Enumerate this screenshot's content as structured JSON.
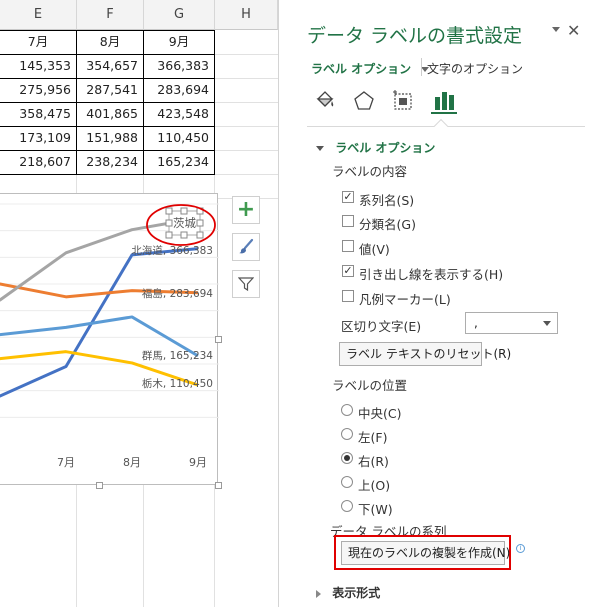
{
  "sheet": {
    "columns": [
      "E",
      "F",
      "G",
      "H"
    ],
    "months": [
      "7月",
      "8月",
      "9月"
    ],
    "rows": [
      [
        "145,353",
        "354,657",
        "366,383"
      ],
      [
        "275,956",
        "287,541",
        "283,694"
      ],
      [
        "358,475",
        "401,865",
        "423,548"
      ],
      [
        "173,109",
        "151,988",
        "110,450"
      ],
      [
        "218,607",
        "238,234",
        "165,234"
      ]
    ]
  },
  "chart_data": {
    "type": "line",
    "categories": [
      "7月",
      "8月",
      "9月"
    ],
    "series": [
      {
        "name": "北海道",
        "values": [
          145353,
          354657,
          366383
        ],
        "color": "#4472c4",
        "label": "北海道, 366,383"
      },
      {
        "name": "福島",
        "values": [
          275956,
          287541,
          283694
        ],
        "color": "#ed7d31",
        "label": "福島, 283,694"
      },
      {
        "name": "茨城",
        "values": [
          358475,
          401865,
          423548
        ],
        "color": "#a5a5a5",
        "label": "茨城"
      },
      {
        "name": "栃木",
        "values": [
          173109,
          151988,
          110450
        ],
        "color": "#ffc000",
        "label": "栃木, 110,450"
      },
      {
        "name": "群馬",
        "values": [
          218607,
          238234,
          165234
        ],
        "color": "#5b9bd5",
        "label": "群馬, 165,234"
      }
    ],
    "ylim": [
      0,
      450000
    ],
    "grid": true
  },
  "chart_buttons": {
    "add_icon": "plus-icon",
    "style_icon": "brush-icon",
    "filter_icon": "filter-icon"
  },
  "pane": {
    "title": "データ ラベルの書式設定",
    "tab_label_options": "ラベル オプション",
    "tab_text_options": "文字のオプション",
    "icons": [
      "fill-bucket-icon",
      "pentagon-icon",
      "size-properties-icon",
      "bar-chart-icon"
    ],
    "section_title": "ラベル オプション",
    "contents_heading": "ラベルの内容",
    "checkboxes": [
      {
        "label": "系列名(S)",
        "checked": true
      },
      {
        "label": "分類名(G)",
        "checked": false
      },
      {
        "label": "値(V)",
        "checked": false
      },
      {
        "label": "引き出し線を表示する(H)",
        "checked": true
      },
      {
        "label": "凡例マーカー(L)",
        "checked": false
      }
    ],
    "separator_label": "区切り文字(E)",
    "separator_value": ",",
    "reset_button": "ラベル テキストのリセット(R)",
    "position_heading": "ラベルの位置",
    "positions": [
      {
        "label": "中央(C)",
        "selected": false
      },
      {
        "label": "左(F)",
        "selected": false
      },
      {
        "label": "右(R)",
        "selected": true
      },
      {
        "label": "上(O)",
        "selected": false
      },
      {
        "label": "下(W)",
        "selected": false
      }
    ],
    "series_heading": "データ ラベルの系列",
    "clone_button": "現在のラベルの複製を作成(N)",
    "number_format": "表示形式",
    "highlight_color": "#e00000",
    "accent_color": "#217346"
  }
}
